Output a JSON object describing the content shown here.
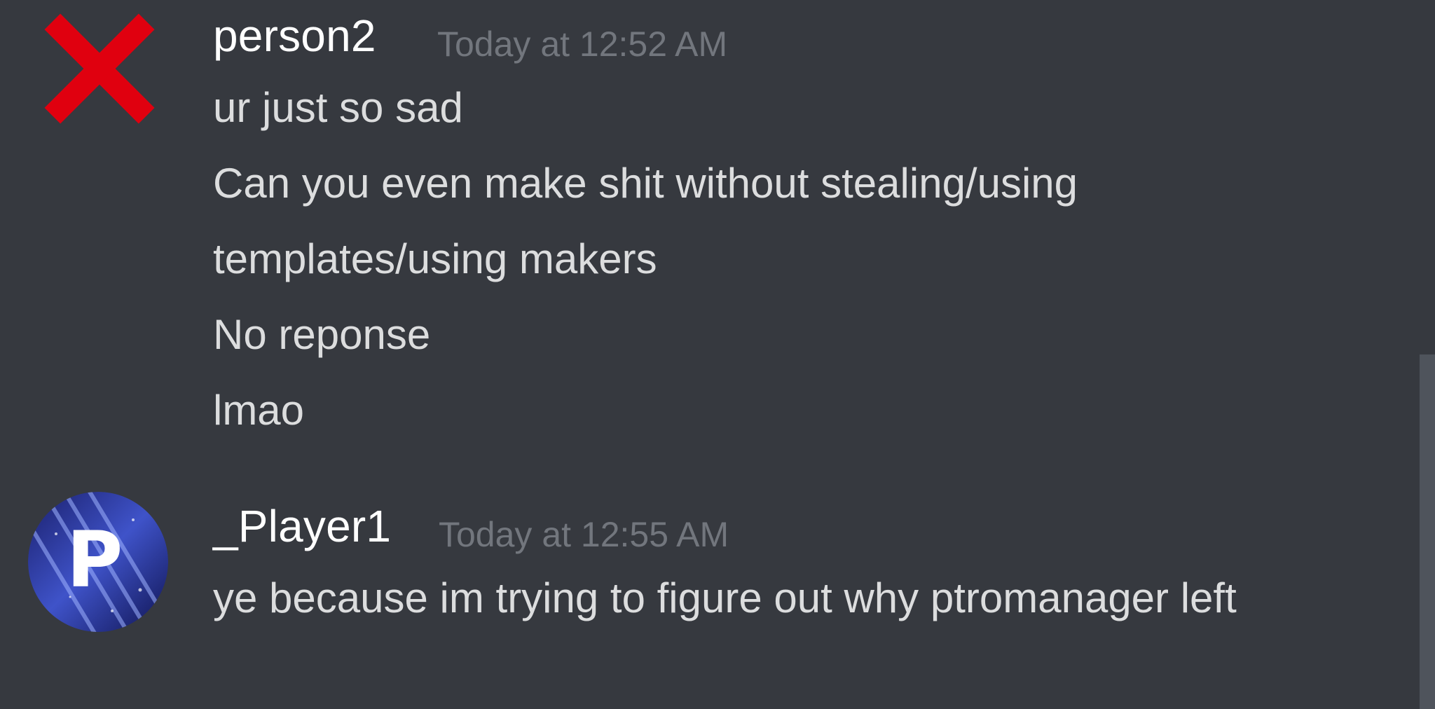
{
  "messages": [
    {
      "username": "person2",
      "timestamp": "Today at 12:52 AM",
      "lines": [
        "ur just so sad",
        "Can you even make shit without stealing/using",
        "templates/using makers",
        "No reponse",
        "lmao"
      ],
      "avatar_icon": "red-x-icon"
    },
    {
      "username": "_Player1",
      "timestamp": "Today at 12:55 AM",
      "lines": [
        "ye because im trying to figure out why ptromanager left"
      ],
      "avatar_icon": "p-letter-avatar",
      "avatar_letter": "P"
    }
  ],
  "colors": {
    "background": "#36393f",
    "username": "#ffffff",
    "timestamp": "#72767d",
    "message_text": "#dcddde",
    "x_icon": "#e0000f",
    "scrollbar": "#4f545c"
  }
}
